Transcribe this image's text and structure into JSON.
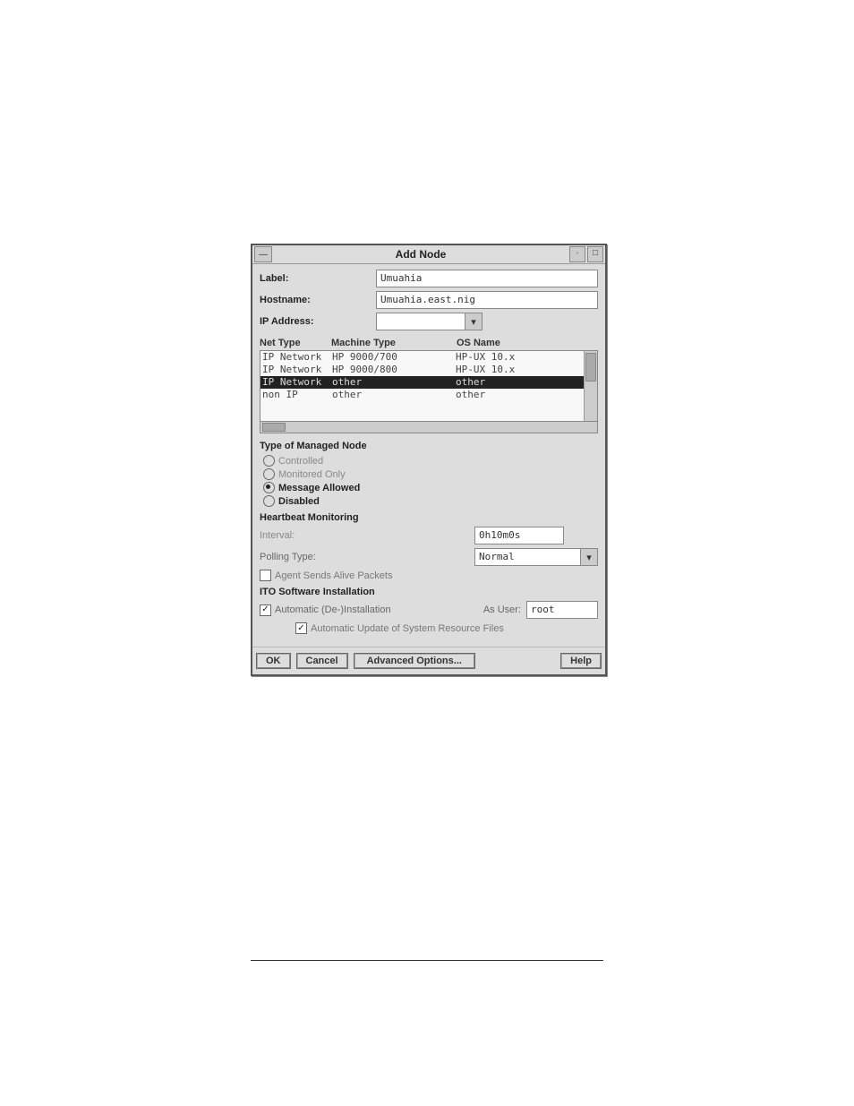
{
  "window": {
    "title": "Add Node"
  },
  "fields": {
    "label_lbl": "Label:",
    "label_val": "Umuahia",
    "hostname_lbl": "Hostname:",
    "hostname_val": "Umuahia.east.nig",
    "ip_lbl": "IP Address:",
    "ip_val": ""
  },
  "headers": {
    "nettype": "Net Type",
    "machine": "Machine Type",
    "osname": "OS Name"
  },
  "rows": [
    {
      "net": "IP Network",
      "machine": "HP 9000/700",
      "os": "HP-UX 10.x",
      "selected": false
    },
    {
      "net": "IP Network",
      "machine": "HP 9000/800",
      "os": "HP-UX 10.x",
      "selected": false
    },
    {
      "net": "IP Network",
      "machine": "other",
      "os": "other",
      "selected": true
    },
    {
      "net": "non IP",
      "machine": "other",
      "os": "other",
      "selected": false
    }
  ],
  "managed": {
    "title": "Type of Managed Node",
    "options": {
      "controlled": "Controlled",
      "monitored": "Monitored Only",
      "message": "Message Allowed",
      "disabled": "Disabled"
    },
    "selected": "message"
  },
  "heartbeat": {
    "title": "Heartbeat Monitoring",
    "interval_lbl": "Interval:",
    "interval_val": "0h10m0s",
    "polling_lbl": "Polling Type:",
    "polling_val": "Normal",
    "agent_chk_lbl": "Agent Sends Alive Packets"
  },
  "ito": {
    "title": "ITO Software Installation",
    "auto_lbl": "Automatic (De-)Installation",
    "asuser_lbl": "As User:",
    "asuser_val": "root",
    "update_lbl": "Automatic Update of System Resource Files"
  },
  "buttons": {
    "ok": "OK",
    "cancel": "Cancel",
    "adv": "Advanced Options...",
    "help": "Help"
  }
}
